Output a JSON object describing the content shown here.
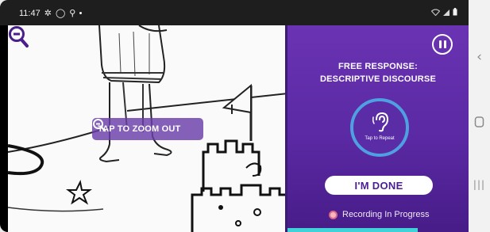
{
  "status_bar": {
    "time": "11:47",
    "icons": [
      "settings-icon",
      "circle-icon",
      "location-pin-icon",
      "notification-dot-icon"
    ],
    "right_icons": [
      "wifi-icon",
      "signal-icon",
      "battery-icon"
    ]
  },
  "picture": {
    "zoom_label": "TAP TO ZOOM OUT",
    "zoom_icon": "zoom-out-icon",
    "corner_zoom_icon": "zoom-out-icon"
  },
  "panel": {
    "title_line1": "FREE RESPONSE:",
    "title_line2": "DESCRIPTIVE DISCOURSE",
    "repeat_caption": "Tap to Repeat",
    "done_label": "I'M DONE",
    "recording_label": "Recording In Progress",
    "progress_fraction": 0.72
  },
  "navigation": {
    "back_icon": "back-chevron-icon",
    "home_icon": "home-icon",
    "recents_icon": "recents-icon"
  },
  "colors": {
    "panel_purple": "#5a29a3",
    "button_text": "#4b1e94",
    "ring_blue": "#4fa0e0",
    "progress_cyan": "#3fd2d8"
  }
}
